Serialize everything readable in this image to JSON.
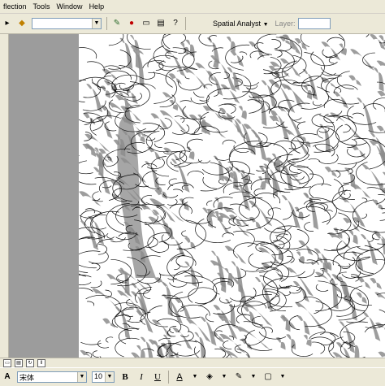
{
  "menu": {
    "items": [
      "flection",
      "Tools",
      "Window",
      "Help"
    ]
  },
  "toolbar": {
    "layer_combo_value": "",
    "spatial_analyst_label": "Spatial Analyst",
    "layer_label": "Layer:",
    "layer_value": ""
  },
  "drawing": {
    "font_value": "宋体",
    "size_value": "10",
    "bold_label": "B",
    "italic_label": "I",
    "underline_label": "U",
    "font_color_label": "A"
  },
  "map": {
    "background_color": "#ffffff",
    "line_color": "#111111",
    "shadow_color": "#8c8c8c",
    "flat_area_color": "#a6a6a6"
  }
}
